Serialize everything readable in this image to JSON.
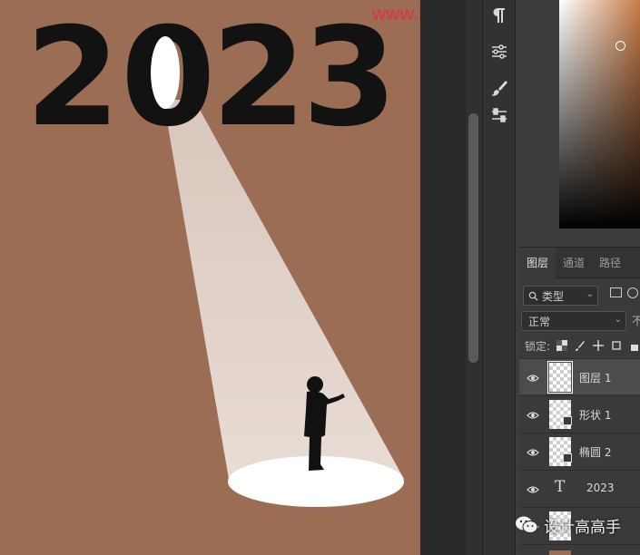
{
  "watermark": "www.haoyishangsheji.com",
  "canvas": {
    "headline": [
      "2",
      "0",
      "2",
      "3"
    ],
    "colors": {
      "background": "#9b6d55",
      "text": "#121212",
      "beam": "#e6d5cc",
      "ellipse": "#ffffff"
    }
  },
  "tools": [
    {
      "name": "paragraph-icon"
    },
    {
      "name": "adjustments-icon"
    },
    {
      "name": "brush-icon"
    },
    {
      "name": "sliders-icon"
    }
  ],
  "layers_panel": {
    "tabs": [
      "图层",
      "通道",
      "路径"
    ],
    "filter": {
      "icon": "search-icon",
      "value": "类型"
    },
    "blend_mode": "正常",
    "opacity_label": "不",
    "lock_label": "锁定:",
    "layers": [
      {
        "name": "图层 1",
        "type": "raster",
        "selected": true
      },
      {
        "name": "形状 1",
        "type": "shape",
        "selected": false
      },
      {
        "name": "椭圆 2",
        "type": "shape",
        "selected": false
      },
      {
        "name": "2023",
        "type": "text",
        "selected": false
      },
      {
        "name": "",
        "type": "raster",
        "selected": false
      },
      {
        "name": "",
        "type": "background",
        "selected": false
      }
    ]
  },
  "brand": {
    "icon": "wechat-icon",
    "text": "设计高高手"
  }
}
